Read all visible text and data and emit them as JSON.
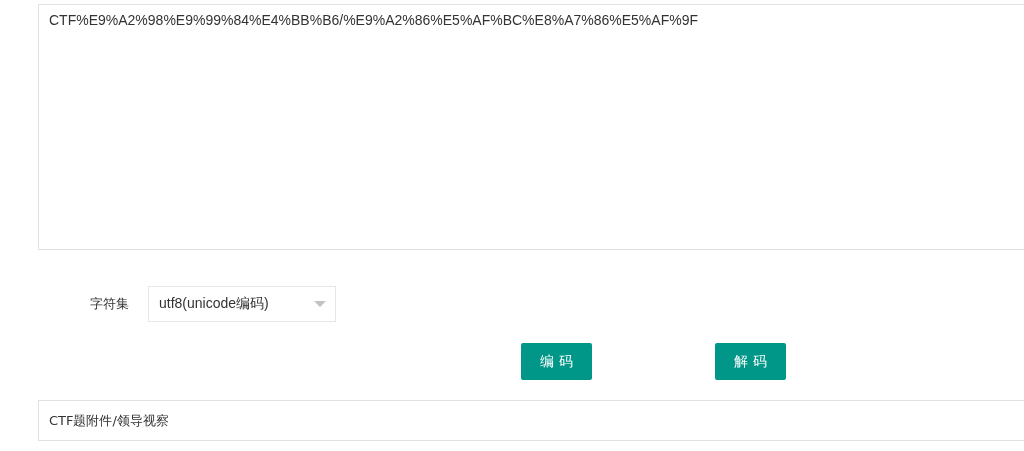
{
  "input_text": {
    "value": "CTF%E9%A2%98%E9%99%84%E4%BB%B6/%E9%A2%86%E5%AF%BC%E8%A7%86%E5%AF%9F"
  },
  "charset": {
    "label": "字符集",
    "value": "utf8(unicode编码)"
  },
  "buttons": [
    {
      "label": "编 码"
    },
    {
      "label": "解 码"
    }
  ],
  "output_text": {
    "value": "CTF题附件/领导视察"
  }
}
